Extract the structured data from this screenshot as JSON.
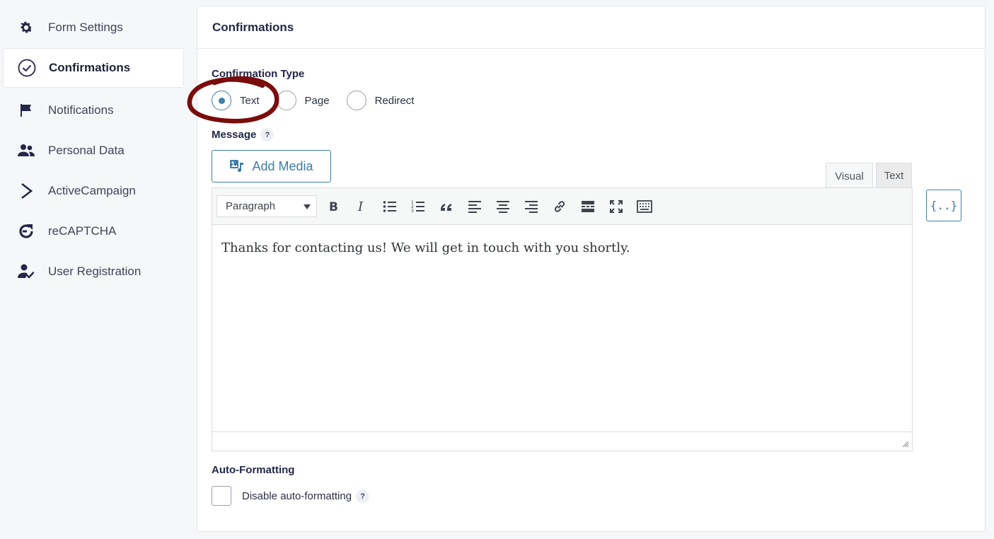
{
  "sidebar": {
    "items": [
      {
        "label": "Form Settings",
        "icon": "gear-icon"
      },
      {
        "label": "Confirmations",
        "icon": "check-circle-icon",
        "active": true
      },
      {
        "label": "Notifications",
        "icon": "flag-icon"
      },
      {
        "label": "Personal Data",
        "icon": "users-icon"
      },
      {
        "label": "ActiveCampaign",
        "icon": "activecampaign-icon"
      },
      {
        "label": "reCAPTCHA",
        "icon": "recaptcha-icon"
      },
      {
        "label": "User Registration",
        "icon": "user-check-icon"
      }
    ]
  },
  "panel": {
    "title": "Confirmations",
    "confirmation_type": {
      "label": "Confirmation Type",
      "options": [
        "Text",
        "Page",
        "Redirect"
      ],
      "selected": "Text"
    },
    "message": {
      "label": "Message",
      "help": "?",
      "add_media_label": "Add Media",
      "tabs": {
        "visual": "Visual",
        "text": "Text"
      },
      "format_select": "Paragraph",
      "content": "Thanks for contacting us! We will get in touch with you shortly.",
      "merge_tags": "{..}"
    },
    "auto_formatting": {
      "label": "Auto-Formatting",
      "checkbox_label": "Disable auto-formatting",
      "help": "?",
      "checked": false
    }
  },
  "colors": {
    "accent": "#3e7da6",
    "annotation": "#7a0c0c"
  }
}
